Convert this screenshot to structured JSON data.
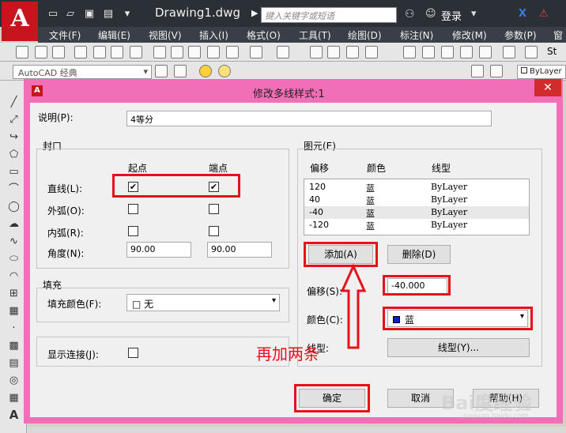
{
  "app": {
    "logo_text": "A",
    "doc_title": "Drawing1.dwg",
    "search_placeholder": "键入关键字或短语",
    "login_label": "登录"
  },
  "menu": [
    "文件(F)",
    "编辑(E)",
    "视图(V)",
    "插入(I)",
    "格式(O)",
    "工具(T)",
    "绘图(D)",
    "标注(N)",
    "修改(M)",
    "参数(P)",
    "窗"
  ],
  "toolbar": {
    "workspace": "AutoCAD 经典",
    "bylayer": "ByLayer",
    "text_style_label": "St"
  },
  "dialog": {
    "title": "修改多线样式:1",
    "icon_text": "A",
    "close_symbol": "✕",
    "description_label": "说明(P):",
    "description_value": "4等分",
    "caps": {
      "group_label": "封口",
      "start_header": "起点",
      "end_header": "端点",
      "line_label": "直线(L):",
      "outer_arc_label": "外弧(O):",
      "inner_arc_label": "内弧(R):",
      "angle_label": "角度(N):",
      "angle_start": "90.00",
      "angle_end": "90.00",
      "check_mark": "✔"
    },
    "fill": {
      "group_label": "填充",
      "color_label": "填充颜色(F):",
      "color_value": "□ 无"
    },
    "joints_label": "显示连接(J):",
    "elements": {
      "group_label": "图元(E)",
      "headers": [
        "偏移",
        "颜色",
        "线型"
      ],
      "rows": [
        {
          "offset": "120",
          "color": "蓝",
          "linetype": "ByLayer"
        },
        {
          "offset": "40",
          "color": "蓝",
          "linetype": "ByLayer"
        },
        {
          "offset": "-40",
          "color": "蓝",
          "linetype": "ByLayer"
        },
        {
          "offset": "-120",
          "color": "蓝",
          "linetype": "ByLayer"
        }
      ],
      "add_button": "添加(A)",
      "delete_button": "删除(D)",
      "offset_label": "偏移(S):",
      "offset_value": "-40.000",
      "color_label": "颜色(C):",
      "color_value": "蓝",
      "linetype_label": "线型:",
      "linetype_button": "线型(Y)..."
    },
    "ok_button": "确定",
    "cancel_button": "取消",
    "help_button": "帮助(H)"
  },
  "annotation_text": "再加两条",
  "watermark": {
    "main": "Bai度经验",
    "sub": "jingyan.baidu.com"
  },
  "colors": {
    "dialog_frame": "#f06fb6",
    "highlight": "#e8101a",
    "blue_swatch": "#0a1bd9"
  }
}
